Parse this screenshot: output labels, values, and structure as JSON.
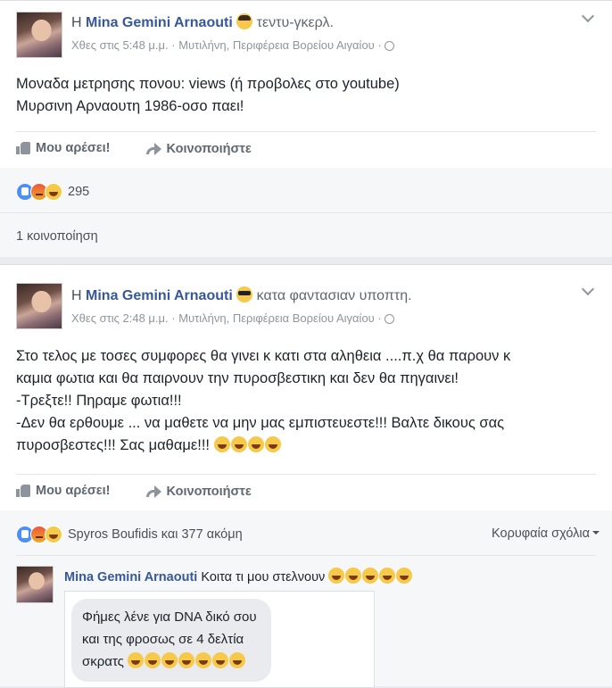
{
  "posts": [
    {
      "author_prefix": "Η",
      "author": "Mina Gemini Arnaouti",
      "activity": "τεντυ-γκερλ.",
      "activity_emoji": "nerd-face-icon",
      "time": "Χθες στις 5:48 μ.μ.",
      "location": "Μυτιλήνη, Περιφέρεια Βορείου Αιγαίου",
      "separator": "·",
      "text_lines": [
        "Μοναδα μετρησης πονου: views (ή προβολες στο youtube)",
        "Μυρσινη Αρναουτη 1986-οσο παει!"
      ],
      "like_label": "Μου αρέσει!",
      "share_label": "Κοινοποιήστε",
      "reaction_count": "295",
      "shares_text": "1 κοινοποίηση"
    },
    {
      "author_prefix": "Η",
      "author": "Mina Gemini Arnaouti",
      "activity": "κατα φαντασιαν υποπτη.",
      "activity_emoji": "sunglasses-face-icon",
      "time": "Χθες στις 2:48 μ.μ.",
      "location": "Μυτιλήνη, Περιφέρεια Βορείου Αιγαίου",
      "separator": "·",
      "text_lines": [
        "Στο τελος με τοσες συμφορες θα γινει κ κατι στα αληθεια ....π.χ θα παρουν κ",
        "καμια φωτια και θα παιρνουν την πυροσβεστικη και δεν θα πηγαινει!",
        "-Τρεξτε!! Πηραμε φωτια!!!",
        "-Δεν θα ερθουμε ... να μαθετε να μην μας εμπιστευεστε!!! Βαλτε δικους σας",
        "πυροσβεστες!!! Σας μαθαμε!!!"
      ],
      "like_label": "Μου αρέσει!",
      "share_label": "Κοινοποιήστε",
      "reaction_text": "Spyros Boufidis και 377 ακόμη",
      "top_comments": "Κορυφαία σχόλια",
      "comment": {
        "author": "Mina Gemini Arnaouti",
        "text": "Κοιτα τι μου στελνουν",
        "image_bubble_lines": [
          "Φήμες λένε για DNA δικό σου",
          "και της φροσως σε 4 δελτία",
          "σκρατς"
        ]
      }
    }
  ],
  "colors": {
    "link": "#365899",
    "background": "#e9ebee",
    "meta": "#90949c"
  }
}
